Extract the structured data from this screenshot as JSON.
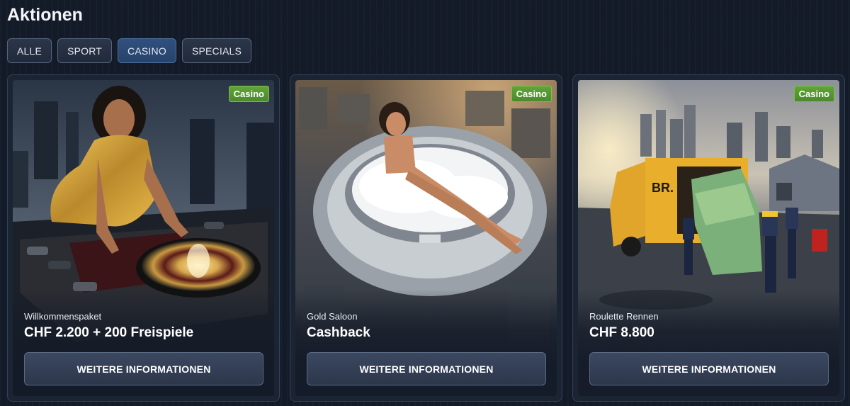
{
  "page": {
    "title": "Aktionen"
  },
  "filters": [
    {
      "label": "ALLE",
      "active": false
    },
    {
      "label": "SPORT",
      "active": false
    },
    {
      "label": "CASINO",
      "active": true
    },
    {
      "label": "SPECIALS",
      "active": false
    }
  ],
  "cards": [
    {
      "badge": "Casino",
      "subtitle": "Willkommenspaket",
      "title": "CHF 2.200 + 200 Freispiele",
      "button": "WEITERE INFORMATIONEN",
      "image": "woman in gold dress at roulette wheel on rooftop"
    },
    {
      "badge": "Casino",
      "subtitle": "Gold Saloon",
      "title": "Cashback",
      "button": "WEITERE INFORMATIONEN",
      "image": "woman in foam bath inside stadium"
    },
    {
      "badge": "Casino",
      "subtitle": "Roulette Rennen",
      "title": "CHF 8.800",
      "button": "WEITERE INFORMATIONEN",
      "image": "delivery workers unloading cash from yellow van",
      "van_logo": "BR."
    }
  ],
  "colors": {
    "background": "#141b28",
    "badge_green": "#5a9c35",
    "active_filter": "#2b4773"
  }
}
